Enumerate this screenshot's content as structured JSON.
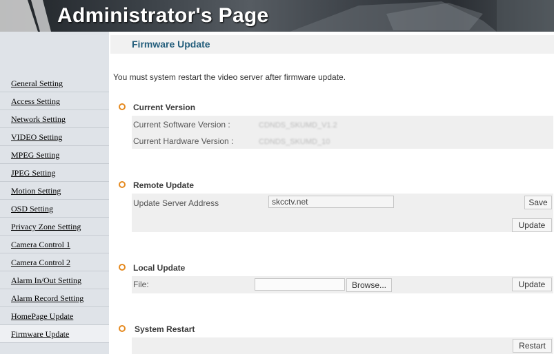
{
  "header": {
    "title": "Administrator's Page"
  },
  "sidebar": {
    "items": [
      {
        "label": "General Setting"
      },
      {
        "label": "Access Setting"
      },
      {
        "label": "Network Setting"
      },
      {
        "label": "VIDEO Setting"
      },
      {
        "label": "MPEG Setting"
      },
      {
        "label": "JPEG Setting"
      },
      {
        "label": "Motion Setting"
      },
      {
        "label": "OSD Setting"
      },
      {
        "label": "Privacy Zone Setting"
      },
      {
        "label": "Camera Control 1"
      },
      {
        "label": "Camera Control 2"
      },
      {
        "label": "Alarm In/Out Setting"
      },
      {
        "label": "Alarm Record Setting"
      },
      {
        "label": "HomePage Update"
      },
      {
        "label": "Firmware Update",
        "active": true
      }
    ]
  },
  "main": {
    "page_title": "Firmware Update",
    "notice": "You must system restart the video server after firmware update.",
    "current_version": {
      "title": "Current Version",
      "software_label": "Current Software Version :",
      "hardware_label": "Current Hardware Version :"
    },
    "remote_update": {
      "title": "Remote Update",
      "server_label": "Update Server Address",
      "server_value": "skcctv.net",
      "save_label": "Save",
      "update_label": "Update"
    },
    "local_update": {
      "title": "Local Update",
      "file_label": "File:",
      "file_value": "",
      "browse_label": "Browse...",
      "update_label": "Update"
    },
    "system_restart": {
      "title": "System Restart",
      "restart_label": "Restart"
    }
  },
  "colors": {
    "accent": "#e58a20",
    "title": "#245e7c",
    "sidebar": "#dfe3e8"
  }
}
